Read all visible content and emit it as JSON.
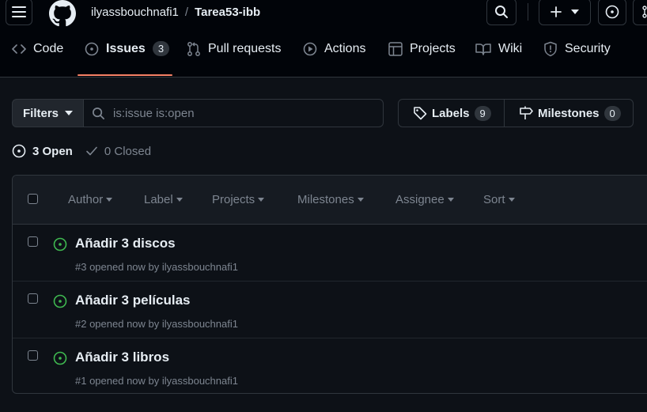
{
  "header": {
    "owner": "ilyassbouchnafi1",
    "separator": "/",
    "repo": "Tarea53-ibb",
    "icons": [
      "hamburger-icon",
      "github-logo",
      "search-icon",
      "plus-icon",
      "triangle-down-icon",
      "issue-opened-icon",
      "pull-request-icon"
    ]
  },
  "nav": {
    "tabs": [
      {
        "label": "Code",
        "icon": "code-icon"
      },
      {
        "label": "Issues",
        "icon": "issue-opened-icon",
        "count": "3",
        "active": true
      },
      {
        "label": "Pull requests",
        "icon": "git-pull-request-icon"
      },
      {
        "label": "Actions",
        "icon": "play-icon"
      },
      {
        "label": "Projects",
        "icon": "table-icon"
      },
      {
        "label": "Wiki",
        "icon": "book-icon"
      },
      {
        "label": "Security",
        "icon": "shield-icon"
      }
    ]
  },
  "toolbar": {
    "filters_label": "Filters",
    "search_value": "is:issue is:open",
    "labels_label": "Labels",
    "labels_count": "9",
    "milestones_label": "Milestones",
    "milestones_count": "0"
  },
  "states": {
    "open": "3 Open",
    "closed": "0 Closed"
  },
  "list_header": {
    "filters": [
      "Author",
      "Label",
      "Projects",
      "Milestones",
      "Assignee",
      "Sort"
    ]
  },
  "issues": [
    {
      "title": "Añadir 3 discos",
      "meta": "#3 opened now by ilyassbouchnafi1"
    },
    {
      "title": "Añadir 3 películas",
      "meta": "#2 opened now by ilyassbouchnafi1"
    },
    {
      "title": "Añadir 3 libros",
      "meta": "#1 opened now by ilyassbouchnafi1"
    }
  ],
  "colors": {
    "background": "#0d1117",
    "open_green": "#3fb950",
    "active_underline": "#f78166",
    "muted": "#7d8590",
    "border": "#30363d"
  }
}
